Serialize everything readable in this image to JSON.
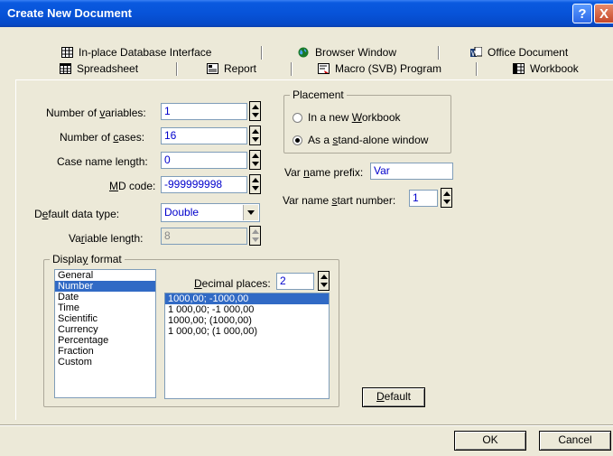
{
  "window": {
    "title": "Create New Document",
    "help_button": "?",
    "close_button": "X"
  },
  "tabs_row1": [
    {
      "label": "In-place Database Interface",
      "icon": "database-grid-icon"
    },
    {
      "label": "Browser Window",
      "icon": "globe-icon"
    },
    {
      "label": "Office Document",
      "icon": "office-document-icon"
    }
  ],
  "tabs_row2": [
    {
      "label": "Spreadsheet",
      "icon": "spreadsheet-icon",
      "active": true
    },
    {
      "label": "Report",
      "icon": "report-icon"
    },
    {
      "label": "Macro (SVB) Program",
      "icon": "macro-icon"
    },
    {
      "label": "Workbook",
      "icon": "workbook-icon"
    }
  ],
  "form": {
    "num_variables": {
      "label_pre": "Number of ",
      "label_u": "v",
      "label_post": "ariables:",
      "value": "1"
    },
    "num_cases": {
      "label_pre": "Number of ",
      "label_u": "c",
      "label_post": "ases:",
      "value": "16"
    },
    "case_name_length": {
      "label": "Case name length:",
      "value": "0"
    },
    "md_code": {
      "label_u": "M",
      "label_post": "D code:",
      "value": "-999999998"
    },
    "default_data_type": {
      "label_pre": "D",
      "label_u": "e",
      "label_post": "fault data type:",
      "value": "Double"
    },
    "variable_length": {
      "label_pre": "Va",
      "label_u": "r",
      "label_post": "iable length:",
      "value": "8"
    }
  },
  "placement": {
    "title": "Placement",
    "option1": {
      "pre": "In a new ",
      "u": "W",
      "post": "orkbook",
      "selected": false
    },
    "option2": {
      "pre": "As a ",
      "u": "s",
      "post": "tand-alone window",
      "selected": true
    }
  },
  "var_prefix": {
    "pre": "Var ",
    "u": "n",
    "post": "ame prefix:",
    "value": "Var"
  },
  "var_start": {
    "pre": "Var name ",
    "u": "s",
    "post": "tart number:",
    "value": "1"
  },
  "display_format": {
    "title_pre": "Displa",
    "title_u": "y",
    "title_post": " format",
    "formats": [
      "General",
      "Number",
      "Date",
      "Time",
      "Scientific",
      "Currency",
      "Percentage",
      "Fraction",
      "Custom"
    ],
    "selected_format": "Number",
    "decimal_pre": "",
    "decimal_u": "D",
    "decimal_post": "ecimal places:",
    "decimal_value": "2",
    "number_styles": [
      "1000,00; -1000,00",
      "1 000,00; -1 000,00",
      "1000,00; (1000,00)",
      "1 000,00; (1 000,00)"
    ],
    "selected_style": "1000,00; -1000,00"
  },
  "buttons": {
    "default_u": "D",
    "default_post": "efault",
    "ok": "OK",
    "cancel": "Cancel"
  },
  "colors": {
    "title_blue": "#0753d8",
    "face": "#ece9d8",
    "select": "#316ac5",
    "value_text": "#0000cc"
  }
}
